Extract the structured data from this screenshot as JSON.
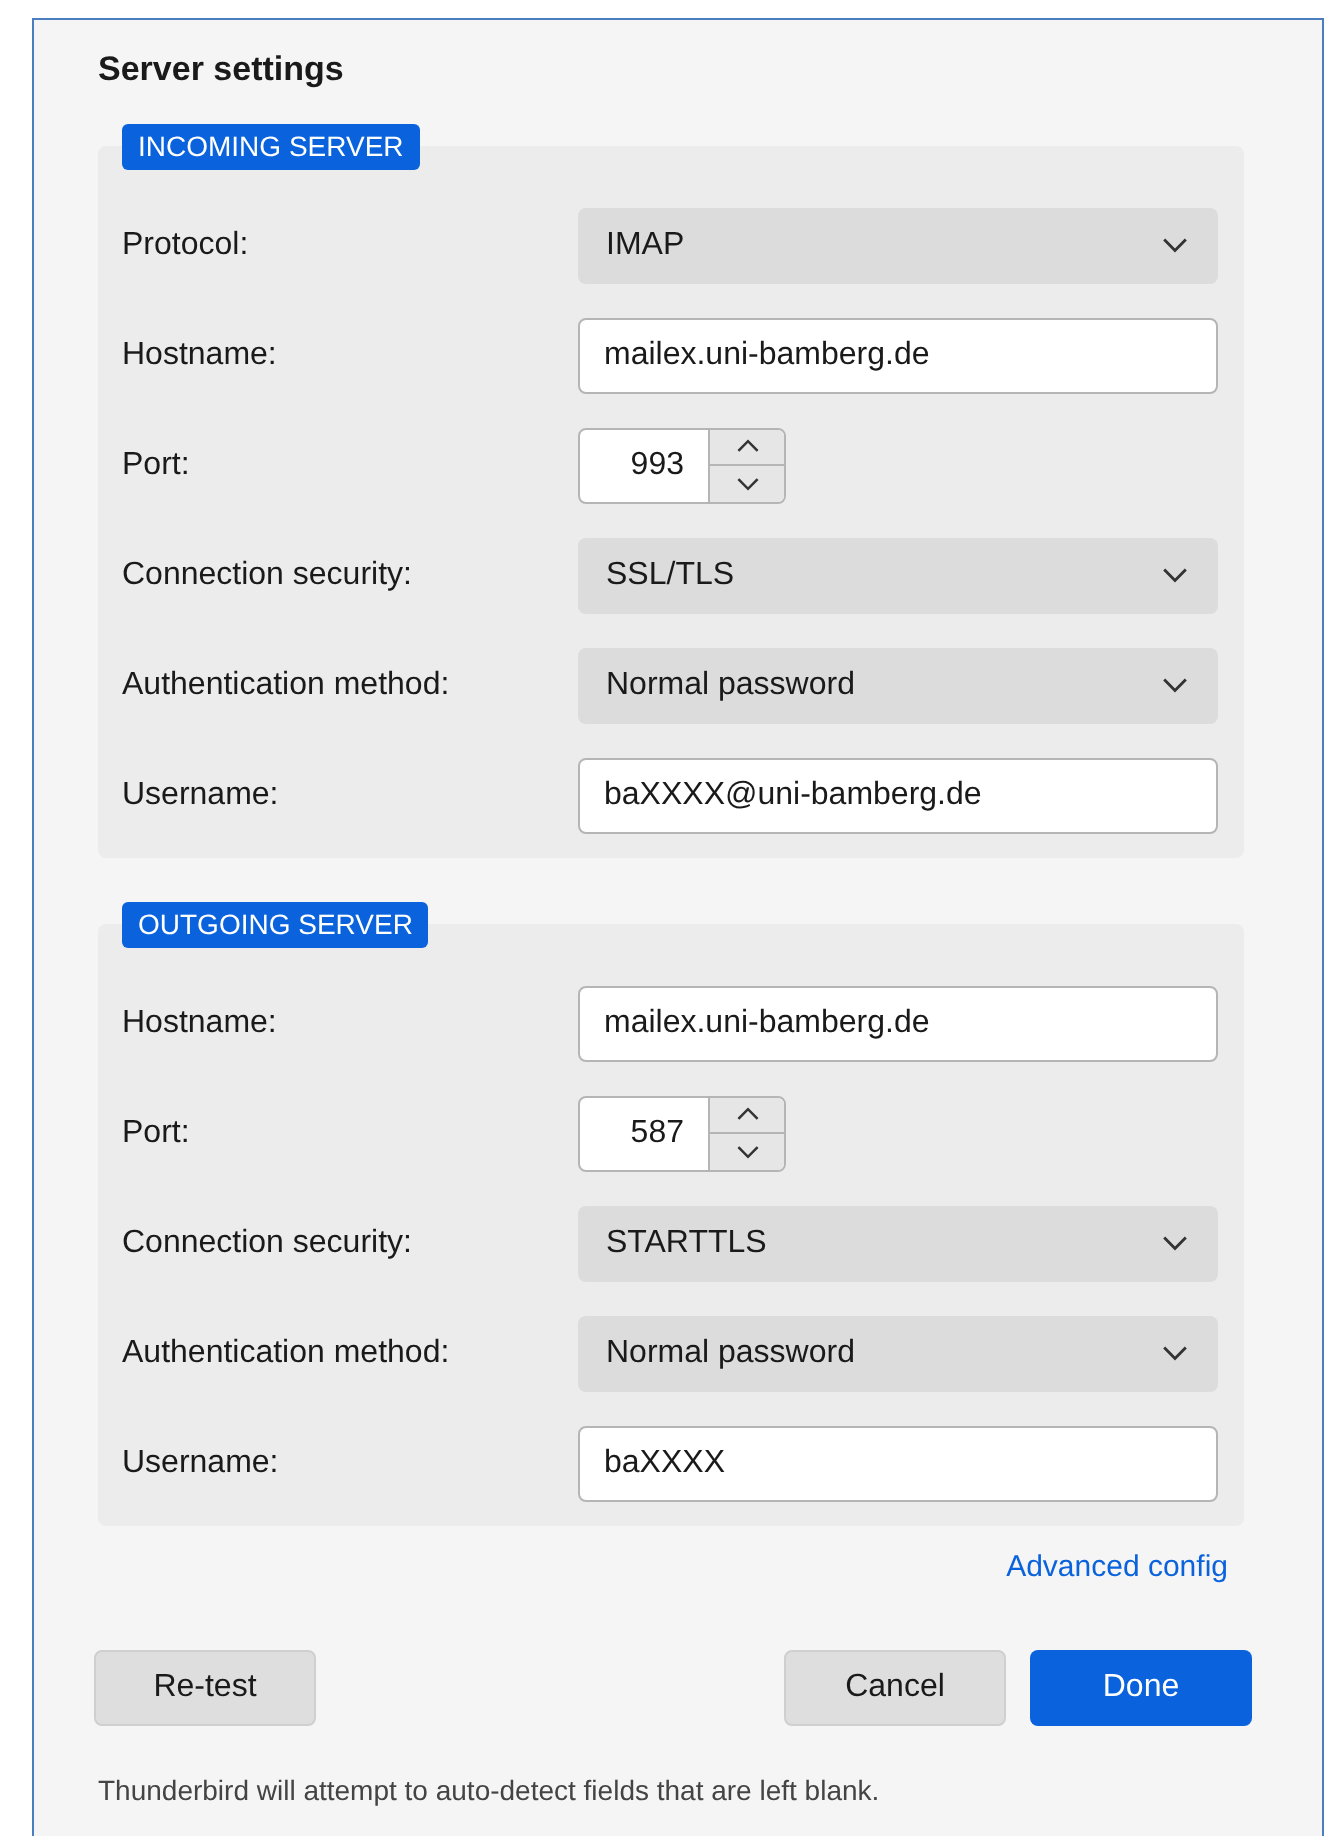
{
  "title": "Server settings",
  "sections": [
    {
      "tag": "INCOMING SERVER",
      "rows": [
        {
          "label": "Protocol:",
          "kind": "select",
          "value": "IMAP"
        },
        {
          "label": "Hostname:",
          "kind": "text",
          "value": "mailex.uni-bamberg.de"
        },
        {
          "label": "Port:",
          "kind": "spinner",
          "value": "993"
        },
        {
          "label": "Connection security:",
          "kind": "select",
          "value": "SSL/TLS"
        },
        {
          "label": "Authentication method:",
          "kind": "select",
          "value": "Normal password"
        },
        {
          "label": "Username:",
          "kind": "text",
          "value": "baXXXX@uni-bamberg.de"
        }
      ]
    },
    {
      "tag": "OUTGOING SERVER",
      "rows": [
        {
          "label": "Hostname:",
          "kind": "text",
          "value": "mailex.uni-bamberg.de"
        },
        {
          "label": "Port:",
          "kind": "spinner",
          "value": "587"
        },
        {
          "label": "Connection security:",
          "kind": "select",
          "value": "STARTTLS"
        },
        {
          "label": "Authentication method:",
          "kind": "select",
          "value": "Normal password"
        },
        {
          "label": "Username:",
          "kind": "text",
          "value": "baXXXX"
        }
      ]
    }
  ],
  "advanced_link": "Advanced config",
  "buttons": [
    {
      "label": "Re-test",
      "kind": "secondary"
    },
    {
      "label": "Cancel",
      "kind": "secondary"
    },
    {
      "label": "Done",
      "kind": "primary"
    }
  ],
  "footer": "Thunderbird will attempt to auto-detect fields that are left blank."
}
